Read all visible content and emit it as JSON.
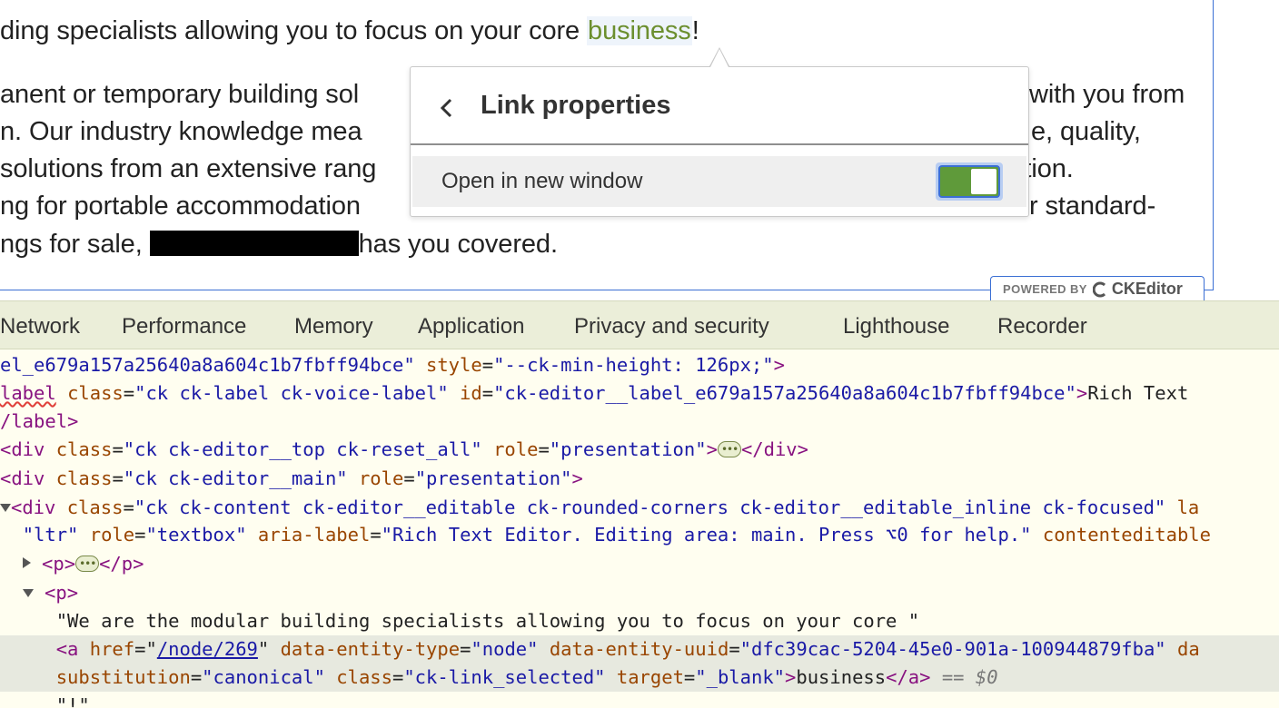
{
  "editor": {
    "lines": [
      {
        "before": "ding specialists allowing you to focus on your core ",
        "link": "business",
        "after": "!"
      },
      {
        "text": "anent or temporary building sol",
        "tail": "with you from"
      },
      {
        "text": "n. Our industry knowledge mea",
        "tail": "e, quality,"
      },
      {
        "text": "solutions from an extensive rang",
        "tail": "ction."
      },
      {
        "text": "ng for portable accommodation",
        "tail": "r standard-"
      },
      {
        "before": "ngs for sale, ",
        "after": "has you covered."
      }
    ],
    "powered_by": "POWERED BY",
    "brand": "CKEditor"
  },
  "link_balloon": {
    "title": "Link properties",
    "switch_label": "Open in new window",
    "switch_on": true,
    "accent_color": "#5f9a3a",
    "focus_color": "#3b6fd4"
  },
  "devtools": {
    "tabs": [
      "Network",
      "Performance",
      "Memory",
      "Application",
      "Privacy and security",
      "Lighthouse",
      "Recorder"
    ],
    "source": {
      "l1_val": "el_e679a157a25640a8a604c1b7fbff94bce\"",
      "l1_attr": "style",
      "l1_val2": "\"--ck-min-height: 126px;\"",
      "l2_tag": "label",
      "l2_attr1": "class",
      "l2_val1": "\"ck ck-label ck-voice-label\"",
      "l2_attr2": "id",
      "l2_val2": "\"ck-editor__label_e679a157a25640a8a604c1b7fbff94bce\"",
      "l2_text": "Rich Text",
      "l3_tag": "/label>",
      "l4_attr1": "class",
      "l4_val1": "\"ck ck-editor__top ck-reset_all\"",
      "l4_attr2": "role",
      "l4_val2": "\"presentation\"",
      "l5_attr1": "class",
      "l5_val1": "\"ck ck-editor__main\"",
      "l5_attr2": "role",
      "l5_val2": "\"presentation\"",
      "l6_attr1": "class",
      "l6_val1": "\"ck ck-content ck-editor__editable ck-rounded-corners ck-editor__editable_inline ck-focused\"",
      "l6_attr2": "la",
      "l7_val1": "\"ltr\"",
      "l7_attr1": "role",
      "l7_val2": "\"textbox\"",
      "l7_attr2": "aria-label",
      "l7_val3": "\"Rich Text Editor. Editing area: main. Press ⌥0 for help.\"",
      "l7_attr3": "contenteditable",
      "l10_text": "\"We are the modular building specialists allowing you to focus on your core \"",
      "l11_attr1": "href",
      "l11_val1": "/node/269",
      "l11_attr2": "data-entity-type",
      "l11_val2": "\"node\"",
      "l11_attr3": "data-entity-uuid",
      "l11_val3": "\"dfc39cac-5204-45e0-901a-100944879fba\"",
      "l11_attr4": "da",
      "l12_attr1": "substitution",
      "l12_val1": "\"canonical\"",
      "l12_attr2": "class",
      "l12_val2": "\"ck-link_selected\"",
      "l12_attr3": "target",
      "l12_val3": "\"_blank\"",
      "l12_text": "business",
      "l12_eq": "== $0",
      "l13_text": "\"!\""
    }
  }
}
